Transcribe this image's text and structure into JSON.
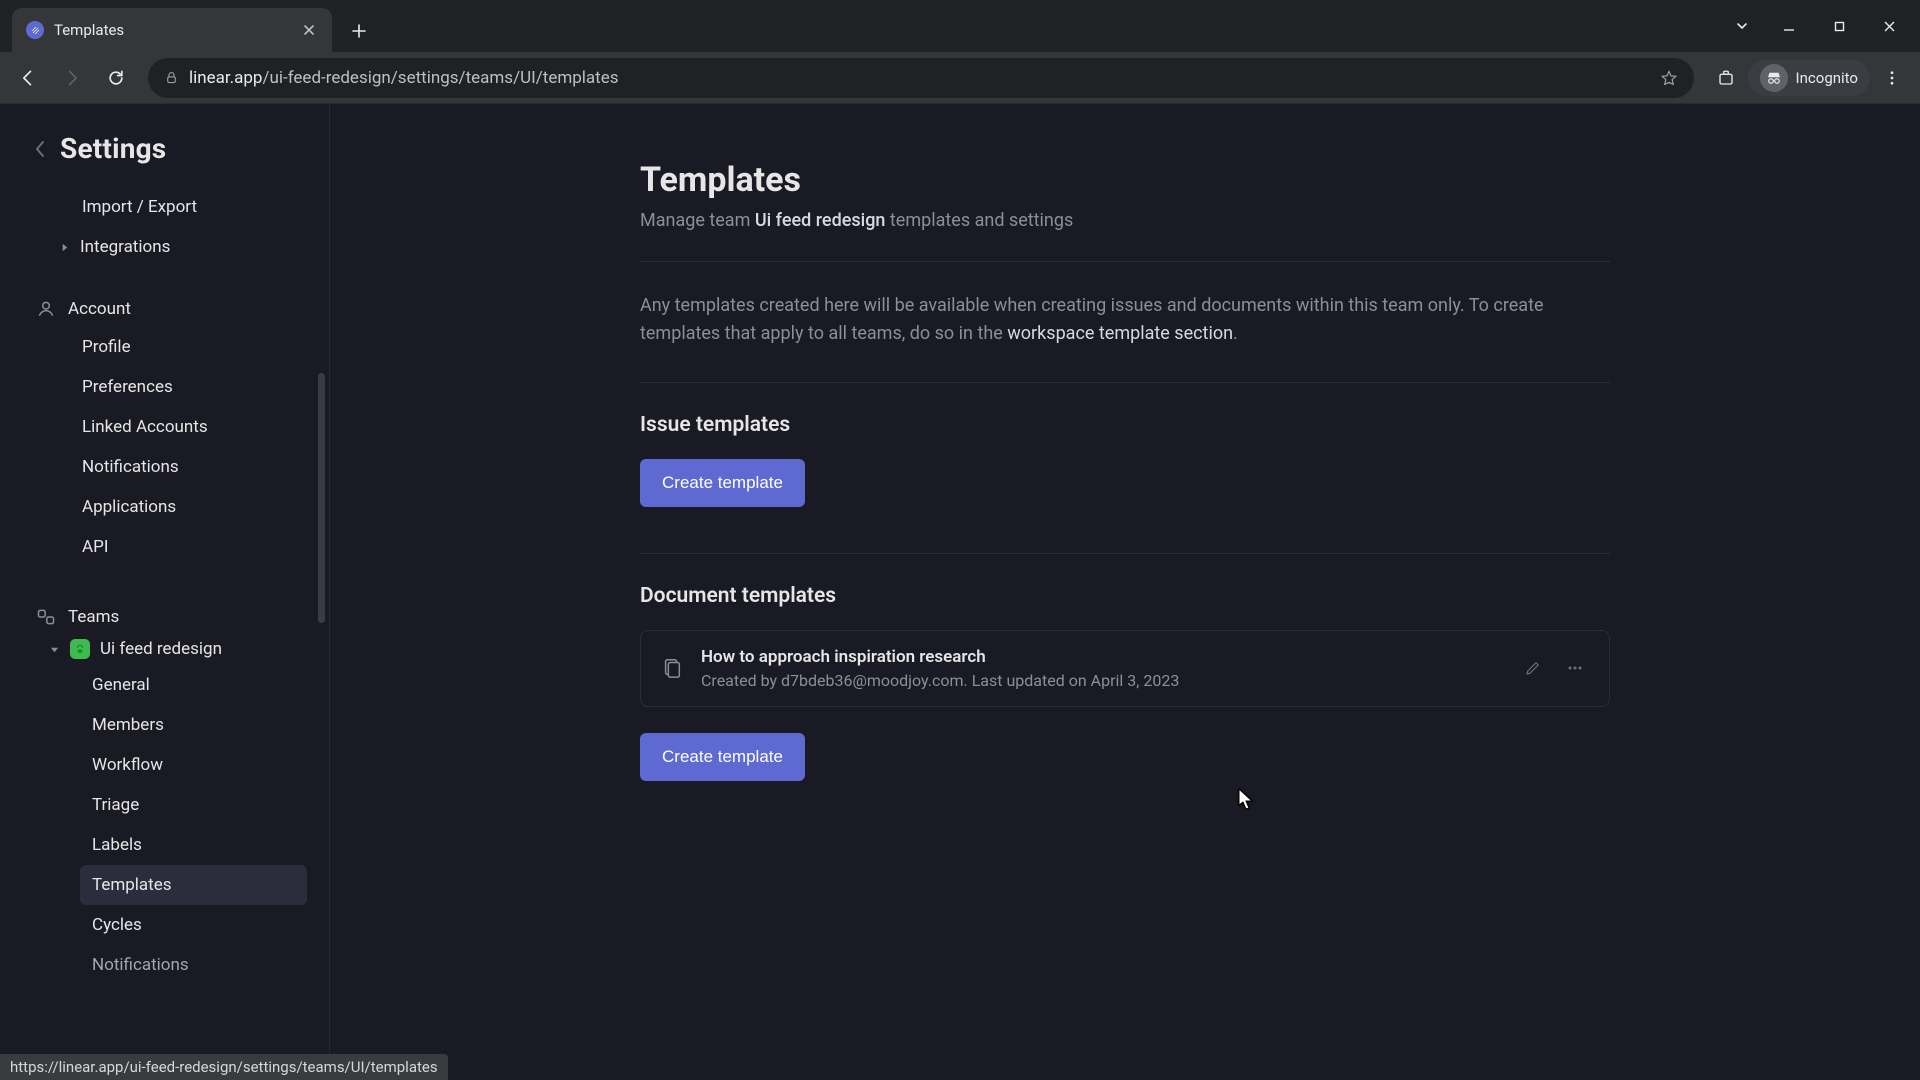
{
  "browser": {
    "tab_title": "Templates",
    "url_host": "linear.app",
    "url_path": "/ui-feed-redesign/settings/teams/UI/templates",
    "incognito_label": "Incognito",
    "status_url": "https://linear.app/ui-feed-redesign/settings/teams/UI/templates"
  },
  "sidebar": {
    "title": "Settings",
    "top_items": [
      {
        "label": "Import / Export"
      },
      {
        "label": "Integrations",
        "expandable": true
      }
    ],
    "account": {
      "heading": "Account",
      "items": [
        {
          "label": "Profile"
        },
        {
          "label": "Preferences"
        },
        {
          "label": "Linked Accounts"
        },
        {
          "label": "Notifications"
        },
        {
          "label": "Applications"
        },
        {
          "label": "API"
        }
      ]
    },
    "teams": {
      "heading": "Teams",
      "team_name": "Ui feed redesign",
      "items": [
        {
          "label": "General"
        },
        {
          "label": "Members"
        },
        {
          "label": "Workflow"
        },
        {
          "label": "Triage"
        },
        {
          "label": "Labels"
        },
        {
          "label": "Templates",
          "active": true
        },
        {
          "label": "Cycles"
        },
        {
          "label": "Notifications"
        }
      ]
    }
  },
  "page": {
    "title": "Templates",
    "subtitle_pre": "Manage team ",
    "subtitle_team": "Ui feed redesign",
    "subtitle_post": " templates and settings",
    "desc_line1": "Any templates created here will be available when creating issues and documents within this team only. ",
    "desc_line2": "To create templates that apply to all teams, do so in the ",
    "desc_link": "workspace template section",
    "desc_end": ".",
    "issue_heading": "Issue templates",
    "create_template_label": "Create template",
    "doc_heading": "Document templates",
    "doc_row": {
      "title": "How to approach inspiration research",
      "sub_prefix": "Created by ",
      "sub_email": "d7bdeb36@moodjoy.com",
      "sub_mid": ". Last updated on ",
      "sub_date": "April 3, 2023"
    }
  }
}
